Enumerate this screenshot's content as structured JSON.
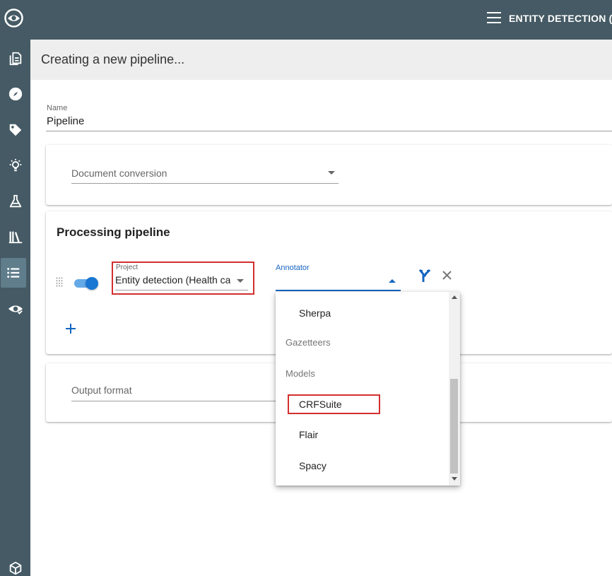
{
  "app": {
    "window_title": "ENTITY DETECTION (H",
    "page_title": "Creating a new pipeline..."
  },
  "sidebar": {
    "items": [
      {
        "icon": "document-icon"
      },
      {
        "icon": "compass-icon"
      },
      {
        "icon": "tag-icon"
      },
      {
        "icon": "lightbulb-icon"
      },
      {
        "icon": "flask-icon"
      },
      {
        "icon": "library-icon"
      },
      {
        "icon": "list-icon",
        "active": true
      },
      {
        "icon": "eye-check-icon"
      }
    ],
    "bottom_icon": "cube-icon"
  },
  "form": {
    "name_label": "Name",
    "name_value": "Pipeline",
    "document_conversion_placeholder": "Document conversion",
    "processing_title": "Processing pipeline",
    "project_label": "Project",
    "project_value": "Entity detection (Health care)",
    "annotator_label": "Annotator",
    "annotator_value": "",
    "output_format_placeholder": "Output format"
  },
  "dropdown": {
    "items": [
      {
        "type": "option",
        "label": "Sherpa"
      },
      {
        "type": "group",
        "label": "Gazetteers"
      },
      {
        "type": "group",
        "label": "Models"
      },
      {
        "type": "option",
        "label": "CRFSuite",
        "highlighted": true
      },
      {
        "type": "option",
        "label": "Flair"
      },
      {
        "type": "option",
        "label": "Spacy"
      }
    ]
  },
  "colors": {
    "sidebar": "#455a64",
    "accent": "#1565c0",
    "highlight_box": "#d32f2f",
    "toggle_on": "#1976d2"
  }
}
